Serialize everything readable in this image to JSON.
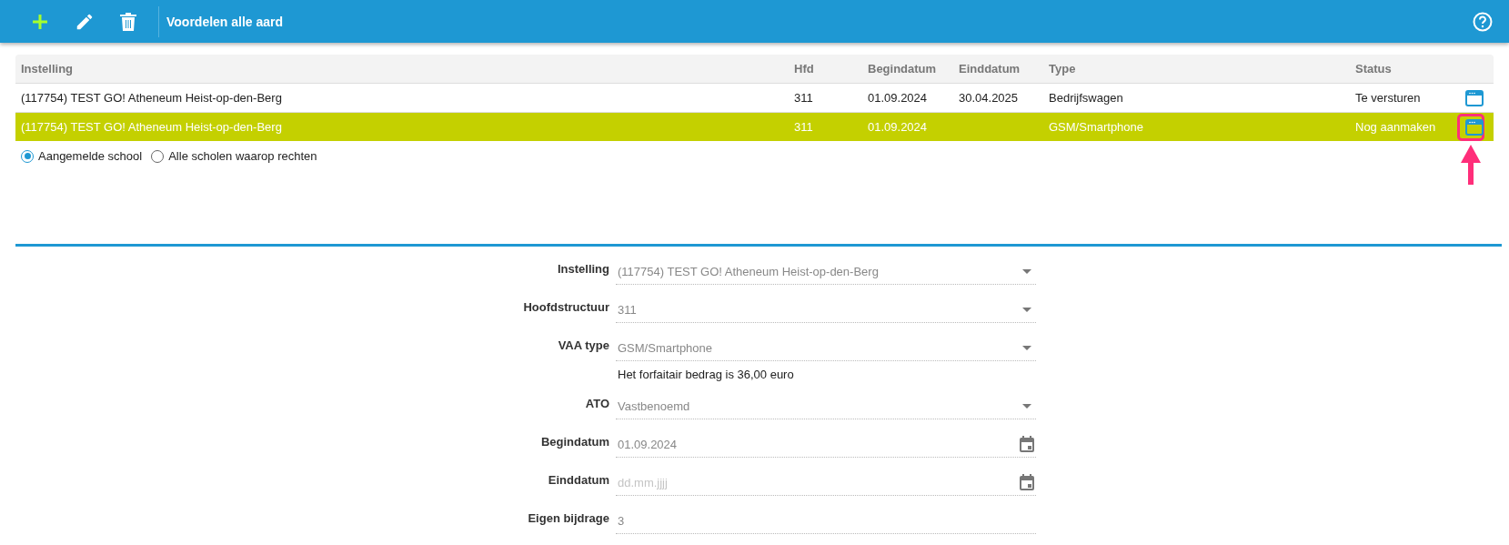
{
  "toolbar": {
    "title": "Voordelen alle aard",
    "buttons": [
      {
        "kind": "add"
      },
      {
        "kind": "edit"
      },
      {
        "kind": "delete"
      }
    ],
    "help": true
  },
  "table": {
    "columns": [
      "Instelling",
      "Hfd",
      "Begindatum",
      "Einddatum",
      "Type",
      "Status"
    ],
    "rows": [
      {
        "cells": [
          "(117754) TEST GO! Atheneum Heist-op-den-Berg",
          "311",
          "01.09.2024",
          "30.04.2025",
          "Bedrijfswagen",
          "Te versturen"
        ],
        "selected": false,
        "callout": false
      },
      {
        "cells": [
          "(117754) TEST GO! Atheneum Heist-op-den-Berg",
          "311",
          "01.09.2024",
          "",
          "GSM/Smartphone",
          "Nog aanmaken"
        ],
        "selected": true,
        "callout": true
      }
    ]
  },
  "scope": [
    {
      "label": "Aangemelde school",
      "selected": true
    },
    {
      "label": "Alle scholen waarop rechten",
      "selected": false
    }
  ],
  "form": [
    {
      "label": "Instelling",
      "kind": "select",
      "value": "(117754) TEST GO! Atheneum Heist-op-den-Berg"
    },
    {
      "label": "Hoofdstructuur",
      "kind": "select",
      "value": "311"
    },
    {
      "label": "VAA type",
      "kind": "select",
      "value": "GSM/Smartphone",
      "hint": "Het forfaitair bedrag is 36,00 euro"
    },
    {
      "label": "ATO",
      "kind": "select",
      "value": "Vastbenoemd"
    },
    {
      "label": "Begindatum",
      "kind": "date",
      "value": "01.09.2024"
    },
    {
      "label": "Einddatum",
      "kind": "date",
      "placeholder": "dd.mm.jjjj"
    },
    {
      "label": "Eigen bijdrage",
      "kind": "text",
      "value": "3"
    }
  ]
}
